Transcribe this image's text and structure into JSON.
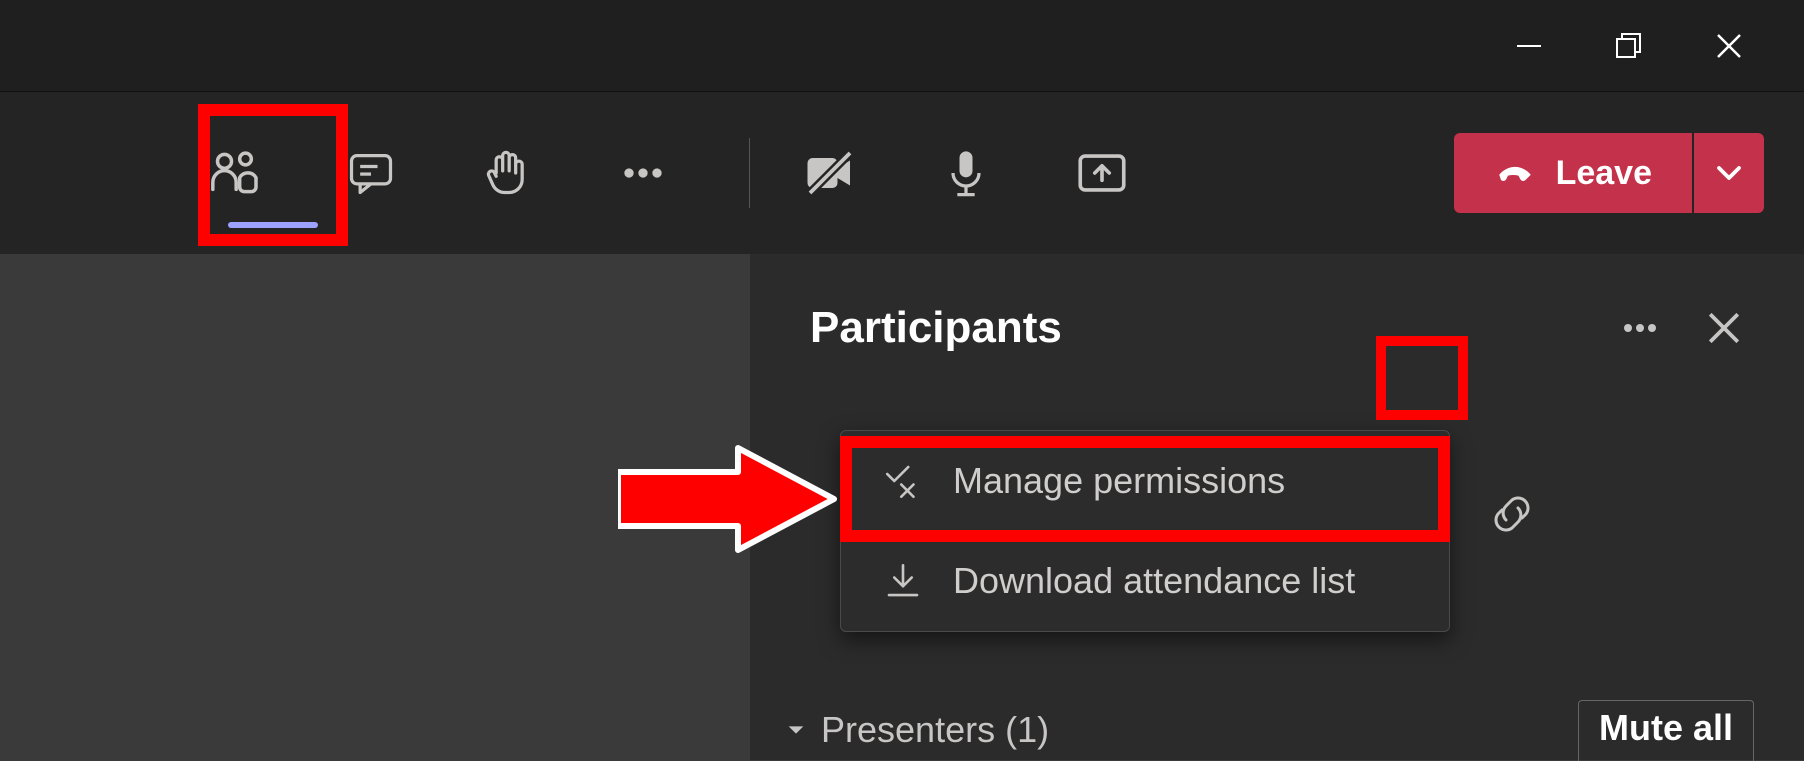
{
  "window_controls": {
    "minimize": "minimize",
    "maximize": "maximize",
    "close": "close"
  },
  "toolbar": {
    "people": "People",
    "chat": "Chat",
    "raise_hand": "Raise hand",
    "more": "More actions",
    "camera": "Camera off",
    "mic": "Microphone",
    "share": "Share content",
    "leave_label": "Leave"
  },
  "panel": {
    "title": "Participants",
    "more": "More options",
    "close": "Close"
  },
  "menu": {
    "manage": "Manage permissions",
    "download": "Download attendance list"
  },
  "link_icon": "Copy link",
  "footer": {
    "presenters": "Presenters (1)",
    "mute_all": "Mute all"
  }
}
